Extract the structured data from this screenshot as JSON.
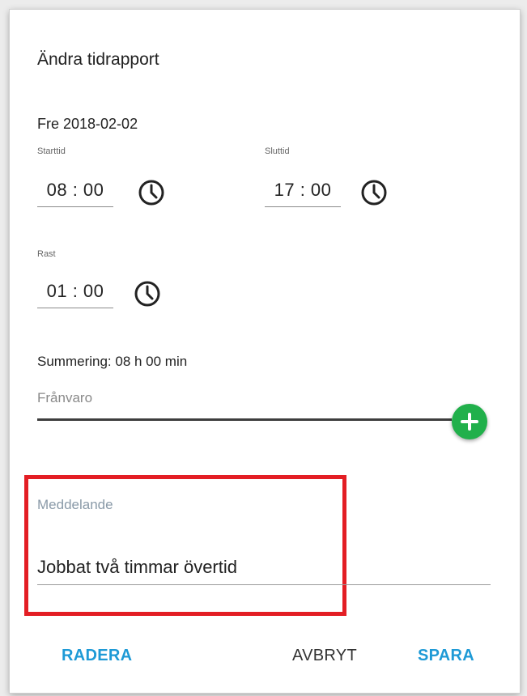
{
  "dialog": {
    "title": "Ändra tidrapport",
    "date": "Fre 2018-02-02",
    "start": {
      "label": "Starttid",
      "value": "08 : 00"
    },
    "end": {
      "label": "Sluttid",
      "value": "17 : 00"
    },
    "break": {
      "label": "Rast",
      "value": "01 : 00"
    },
    "summary": "Summering: 08 h 00 min",
    "absence_label": "Frånvaro",
    "message": {
      "label": "Meddelande",
      "value": "Jobbat två timmar övertid"
    },
    "buttons": {
      "delete": "RADERA",
      "cancel": "AVBRYT",
      "save": "SPARA"
    }
  },
  "icons": {
    "time": "clock-icon",
    "add": "plus-icon"
  },
  "colors": {
    "accent": "#1e9ad6",
    "add_button": "#21b04b",
    "highlight": "#e31e24"
  }
}
